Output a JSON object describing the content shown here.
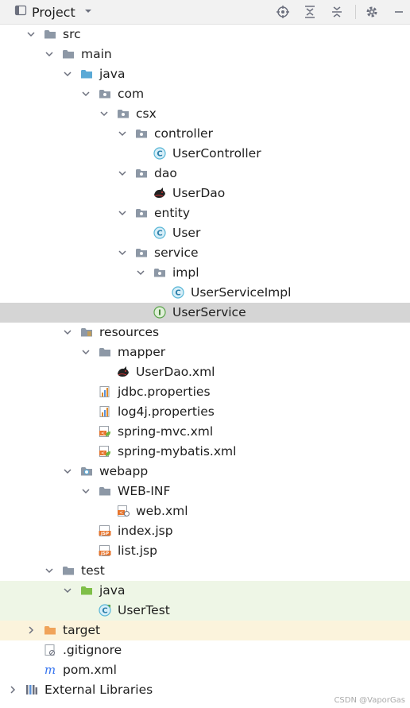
{
  "panel": {
    "title": "Project",
    "toolbar": [
      "locate-icon",
      "expand-all-icon",
      "collapse-all-icon",
      "gear-icon",
      "hide-icon"
    ]
  },
  "colors": {
    "folder": "#8d98a6",
    "source_folder": "#5aa9d6",
    "test_folder": "#7fbf48",
    "excluded_folder": "#f0a35a",
    "class": "#58b6d6",
    "interface": "#5aa34a",
    "selection": "#d5d5d5"
  },
  "tree": [
    {
      "label": "src",
      "icon": "folder-icon",
      "arrow": "chevron-down-icon",
      "level": 0
    },
    {
      "label": "main",
      "icon": "folder-icon",
      "arrow": "chevron-down-icon",
      "level": 1
    },
    {
      "label": "java",
      "icon": "source-folder-icon",
      "arrow": "chevron-down-icon",
      "level": 2
    },
    {
      "label": "com",
      "icon": "package-icon",
      "arrow": "chevron-down-icon",
      "level": 3
    },
    {
      "label": "csx",
      "icon": "package-icon",
      "arrow": "chevron-down-icon",
      "level": 4
    },
    {
      "label": "controller",
      "icon": "package-icon",
      "arrow": "chevron-down-icon",
      "level": 5
    },
    {
      "label": "UserController",
      "icon": "class-icon",
      "arrow": "",
      "level": 6
    },
    {
      "label": "dao",
      "icon": "package-icon",
      "arrow": "chevron-down-icon",
      "level": 5
    },
    {
      "label": "UserDao",
      "icon": "mybatis-icon",
      "arrow": "",
      "level": 6
    },
    {
      "label": "entity",
      "icon": "package-icon",
      "arrow": "chevron-down-icon",
      "level": 5
    },
    {
      "label": "User",
      "icon": "class-icon",
      "arrow": "",
      "level": 6
    },
    {
      "label": "service",
      "icon": "package-icon",
      "arrow": "chevron-down-icon",
      "level": 5
    },
    {
      "label": "impl",
      "icon": "package-icon",
      "arrow": "chevron-down-icon",
      "level": 6
    },
    {
      "label": "UserServiceImpl",
      "icon": "class-icon",
      "arrow": "",
      "level": 7
    },
    {
      "label": "UserService",
      "icon": "interface-icon",
      "arrow": "",
      "level": 6,
      "selected": true
    },
    {
      "label": "resources",
      "icon": "resources-folder-icon",
      "arrow": "chevron-down-icon",
      "level": 2
    },
    {
      "label": "mapper",
      "icon": "folder-icon",
      "arrow": "chevron-down-icon",
      "level": 3
    },
    {
      "label": "UserDao.xml",
      "icon": "mybatis-icon",
      "arrow": "",
      "level": 4
    },
    {
      "label": "jdbc.properties",
      "icon": "properties-icon",
      "arrow": "",
      "level": 3
    },
    {
      "label": "log4j.properties",
      "icon": "properties-icon",
      "arrow": "",
      "level": 3
    },
    {
      "label": "spring-mvc.xml",
      "icon": "spring-xml-icon",
      "arrow": "",
      "level": 3
    },
    {
      "label": "spring-mybatis.xml",
      "icon": "spring-xml-icon",
      "arrow": "",
      "level": 3
    },
    {
      "label": "webapp",
      "icon": "web-folder-icon",
      "arrow": "chevron-down-icon",
      "level": 2
    },
    {
      "label": "WEB-INF",
      "icon": "folder-icon",
      "arrow": "chevron-down-icon",
      "level": 3
    },
    {
      "label": "web.xml",
      "icon": "web-xml-icon",
      "arrow": "",
      "level": 4
    },
    {
      "label": "index.jsp",
      "icon": "jsp-icon",
      "arrow": "",
      "level": 3
    },
    {
      "label": "list.jsp",
      "icon": "jsp-icon",
      "arrow": "",
      "level": 3
    },
    {
      "label": "test",
      "icon": "folder-icon",
      "arrow": "chevron-down-icon",
      "level": 1
    },
    {
      "label": "java",
      "icon": "test-folder-icon",
      "arrow": "chevron-down-icon",
      "level": 2,
      "highlight": "test"
    },
    {
      "label": "UserTest",
      "icon": "test-class-icon",
      "arrow": "",
      "level": 3,
      "highlight": "test"
    },
    {
      "label": "target",
      "icon": "excluded-folder-icon",
      "arrow": "chevron-right-icon",
      "level": 0,
      "highlight": "target"
    },
    {
      "label": ".gitignore",
      "icon": "gitignore-icon",
      "arrow": "",
      "level": 0
    },
    {
      "label": "pom.xml",
      "icon": "maven-icon",
      "arrow": "",
      "level": 0
    },
    {
      "label": "External Libraries",
      "icon": "libraries-icon",
      "arrow": "chevron-right-icon",
      "level": -1
    }
  ],
  "watermark": "CSDN @VaporGas"
}
